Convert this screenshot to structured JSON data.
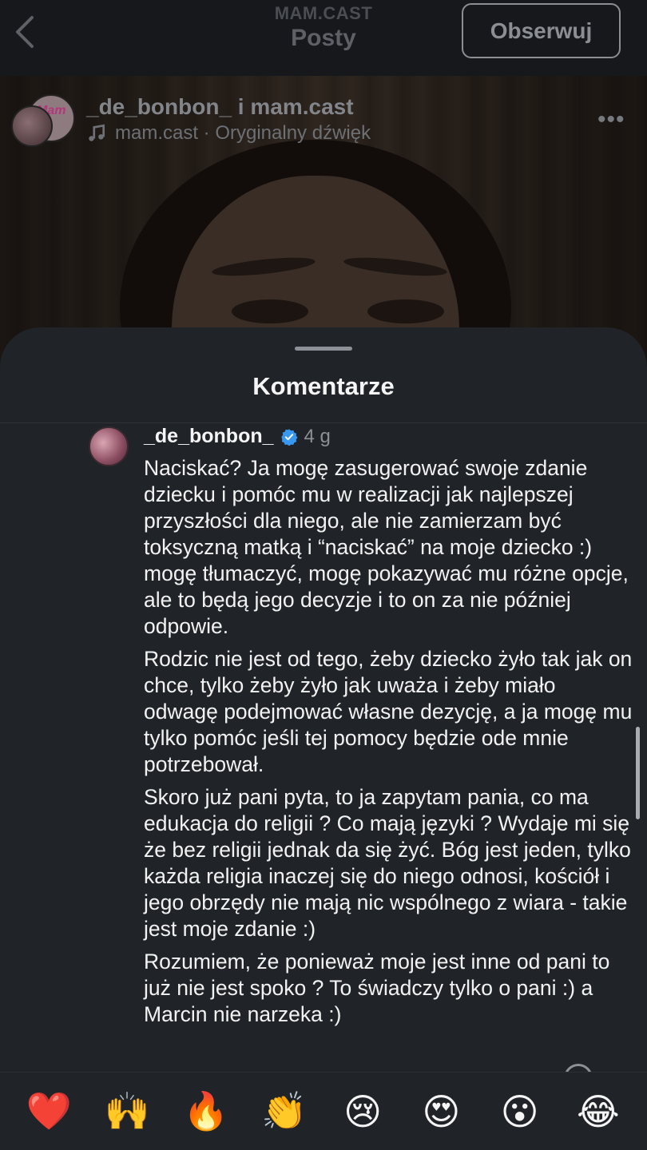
{
  "header": {
    "account": "MAM.CAST",
    "title": "Posty",
    "follow_label": "Obserwuj"
  },
  "post": {
    "author_line": "_de_bonbon_ i mam.cast",
    "audio_line": "mam.cast · Oryginalny dźwięk",
    "avatar_badge": "Mam"
  },
  "comments_sheet": {
    "title": "Komentarze"
  },
  "comment": {
    "username": "_de_bonbon_",
    "time": "4 g",
    "paragraphs": [
      "Naciskać? Ja mogę zasugerować swoje zdanie dziecku i pomóc mu w realizacji jak najlepszej przyszłości dla niego, ale nie zamierzam być toksyczną matką i “naciskać” na moje dziecko :) mogę tłumaczyć, mogę pokazywać mu różne opcje, ale to będą jego decyzje i to on za nie później odpowie.",
      "Rodzic nie jest od tego, żeby dziecko żyło tak jak on chce, tylko żeby żyło jak uważa i żeby miało odwagę podejmować własne dezycję, a ja mogę mu tylko pomóc jeśli tej pomocy będzie ode mnie potrzebował.",
      "Skoro już pani pyta, to ja zapytam pania, co ma edukacja do religii ? Co mają języki ? Wydaje mi się że bez religii jednak da się żyć. Bóg jest jeden, tylko każda religia inaczej się do niego odnosi, kościół i jego obrzędy nie mają nic wspólnego z wiara - takie jest moje zdanie :)",
      "Rozumiem, że ponieważ moje jest inne od pani to już nie jest spoko ? To świadczy tylko o pani :) a Marcin nie narzeka :)"
    ]
  },
  "reactions": [
    "❤️",
    "🙌",
    "🔥",
    "👏",
    "😢",
    "😍",
    "😮",
    "😂"
  ],
  "icons": {
    "back": "chevron-left-icon",
    "audio": "music-note-icon",
    "more": "more-horizontal-icon",
    "verified": "verified-badge-icon"
  },
  "colors": {
    "sheet_bg": "#202327",
    "verified_blue": "#3897f0"
  }
}
